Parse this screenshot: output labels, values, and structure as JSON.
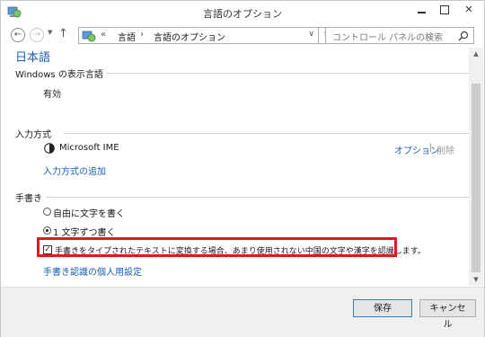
{
  "window": {
    "title": "言語のオプション",
    "controls": {
      "minimize": "minimize-icon",
      "maximize": "maximize-icon",
      "close": "✕"
    }
  },
  "nav": {
    "back_glyph": "←",
    "forward_glyph": "→",
    "dropdown_glyph": "▼",
    "up_glyph": "↑",
    "breadcrumb_prefix": "«",
    "breadcrumbs": [
      "言語",
      "言語のオプション"
    ],
    "breadcrumb_separator": "›",
    "address_dropdown_glyph": "∨",
    "refresh_glyph": "↻",
    "search_placeholder": "コントロール パネルの検索"
  },
  "main": {
    "language_heading": "日本語",
    "display_language": {
      "title": "Windows の表示言語",
      "status": "有効"
    },
    "input_methods": {
      "title": "入力方式",
      "ime_name": "Microsoft IME",
      "options_link": "オプション",
      "separator": "|",
      "delete_label": "削除",
      "add_link": "入力方式の追加"
    },
    "handwriting": {
      "title": "手書き",
      "radio_freeform": "自由に文字を書く",
      "radio_single": "1 文字ずつ書く",
      "selected_radio": "1 文字ずつ書く",
      "checkbox_label": "手書きをタイプされたテキストに変換する場合、あまり使用されない中国の文字や漢字を認識します。",
      "checkbox_checked": true,
      "checkmark": "✓",
      "personalize_link": "手書き認識の個人用設定"
    }
  },
  "footer": {
    "save_label": "保存",
    "cancel_label": "キャンセル"
  },
  "colors": {
    "link": "#1a5fb4",
    "highlight": "#e4151b"
  }
}
